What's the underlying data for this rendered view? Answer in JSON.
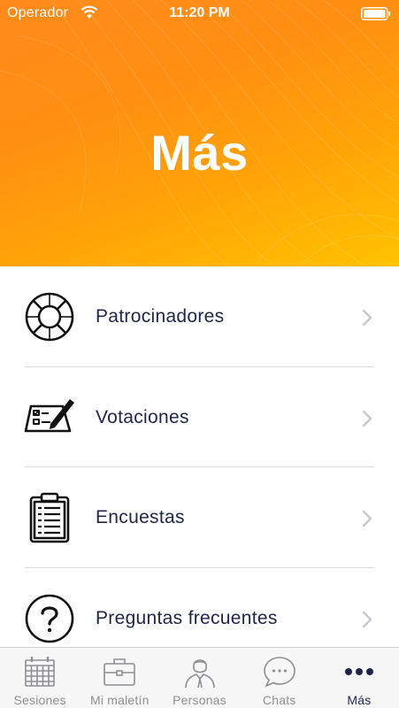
{
  "status_bar": {
    "carrier": "Operador",
    "time": "11:20 PM"
  },
  "header": {
    "title": "Más"
  },
  "menu": {
    "items": [
      {
        "label": "Patrocinadores",
        "icon": "lifebuoy-icon"
      },
      {
        "label": "Votaciones",
        "icon": "ballot-pencil-icon"
      },
      {
        "label": "Encuestas",
        "icon": "clipboard-icon"
      },
      {
        "label": "Preguntas frecuentes",
        "icon": "question-circle-icon"
      }
    ]
  },
  "tabbar": {
    "tabs": [
      {
        "label": "Sesiones",
        "icon": "calendar-icon",
        "active": false
      },
      {
        "label": "Mi maletín",
        "icon": "briefcase-icon",
        "active": false
      },
      {
        "label": "Personas",
        "icon": "person-icon",
        "active": false
      },
      {
        "label": "Chats",
        "icon": "chat-bubble-icon",
        "active": false
      },
      {
        "label": "Más",
        "icon": "more-dots-icon",
        "active": true
      }
    ]
  },
  "colors": {
    "accent_navy": "#1e2547",
    "header_gradient_start": "#ff8a1c",
    "header_gradient_end": "#ffc200",
    "inactive_tab": "#8e8e93"
  }
}
